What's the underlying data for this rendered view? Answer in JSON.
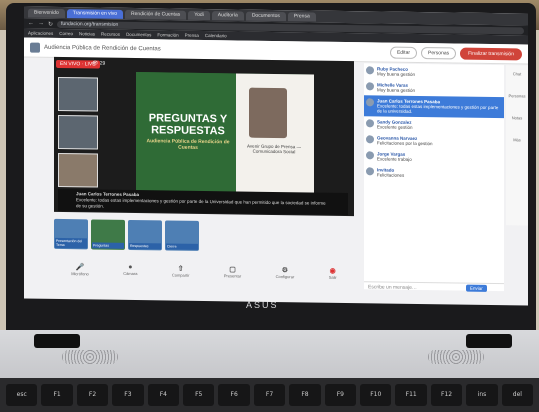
{
  "browser": {
    "tabs": [
      "Bienvenido",
      "Transmisión en vivo",
      "Rendición de Cuentas",
      "Yodi",
      "Auditoría",
      "Documentos",
      "Prensa"
    ],
    "url": "fundacion.org/transmision",
    "bookmarks": [
      "Aplicaciones",
      "Correo",
      "Noticias",
      "Recursos",
      "Documentos",
      "Formación",
      "Prensa",
      "Calendario"
    ]
  },
  "meeting": {
    "header_title": "Audiencia Pública de Rendición de Cuentas",
    "btn_settings": "Editar",
    "btn_people": "Personas",
    "btn_leave": "Finalizar transmisión",
    "live_badge": "EN VIVO · LIVE",
    "viewers": "29",
    "slide_title": "PREGUNTAS Y RESPUESTAS",
    "slide_subtitle": "Audiencia Pública de Rendición de Cuentas",
    "host_name": "Avenir Grupo de Prensa — Comunicadora Social",
    "caption_name": "Juan Carlos Terrones Pasaba",
    "caption_text": "Excelente: todas estas implementaciones y gestión por parte de la Universidad que han permitido que la sociedad se informe de su gestión."
  },
  "thumbnails": [
    "Presentación del Tema",
    "Preguntas",
    "Respuestas",
    "Cierre"
  ],
  "toolbar": [
    "Micrófono",
    "Cámara",
    "Compartir",
    "Presentar",
    "Configurar",
    "Salir"
  ],
  "chat": {
    "messages": [
      {
        "name": "Ruby Pacheco",
        "text": "Muy buena gestión"
      },
      {
        "name": "Michelle Varas",
        "text": "Muy buena gestión"
      },
      {
        "name": "Juan Carlos Terrones Pasaba",
        "text": "Excelente: todas estas implementaciones y gestión por parte de la universidad.",
        "hl": true
      },
      {
        "name": "Sandy Gonzalez",
        "text": "Excelente gestión"
      },
      {
        "name": "Geovanna Narvaez",
        "text": "Felicitaciones por la gestión"
      },
      {
        "name": "Jorge Vargas",
        "text": "Excelente trabajo"
      },
      {
        "name": "Invitado",
        "text": "Felicitaciones"
      }
    ],
    "compose_placeholder": "Escribe un mensaje…",
    "send": "Enviar"
  },
  "rail": [
    "Chat",
    "Personas",
    "Notas",
    "Más"
  ],
  "brand": "ASUS",
  "keys": [
    "esc",
    "F1",
    "F2",
    "F3",
    "F4",
    "F5",
    "F6",
    "F7",
    "F8",
    "F9",
    "F10",
    "F11",
    "F12",
    "ins",
    "del"
  ]
}
